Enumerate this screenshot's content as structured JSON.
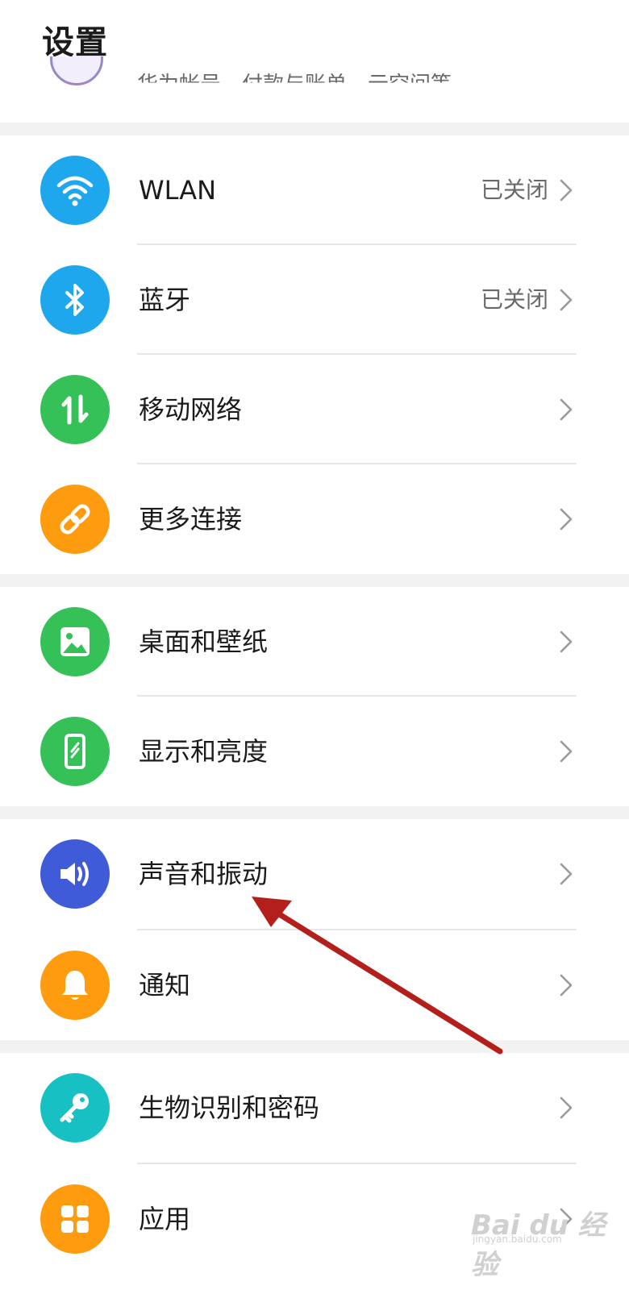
{
  "header": {
    "title": "设置"
  },
  "account": {
    "subtitle": "华为帐号、付款与账单、云空间等"
  },
  "groups": [
    {
      "items": [
        {
          "label": "WLAN",
          "value": "已关闭",
          "icon": "wifi-icon",
          "color": "#1ea7ec"
        },
        {
          "label": "蓝牙",
          "value": "已关闭",
          "icon": "bluetooth-icon",
          "color": "#1ea7ec"
        },
        {
          "label": "移动网络",
          "value": "",
          "icon": "mobile-data-icon",
          "color": "#36c158"
        },
        {
          "label": "更多连接",
          "value": "",
          "icon": "link-icon",
          "color": "#ff9b0f"
        }
      ]
    },
    {
      "items": [
        {
          "label": "桌面和壁纸",
          "value": "",
          "icon": "wallpaper-icon",
          "color": "#36c158"
        },
        {
          "label": "显示和亮度",
          "value": "",
          "icon": "display-icon",
          "color": "#36c158"
        }
      ]
    },
    {
      "items": [
        {
          "label": "声音和振动",
          "value": "",
          "icon": "sound-icon",
          "color": "#3f5bd8"
        },
        {
          "label": "通知",
          "value": "",
          "icon": "bell-icon",
          "color": "#ff9b0f"
        }
      ]
    },
    {
      "items": [
        {
          "label": "生物识别和密码",
          "value": "",
          "icon": "key-icon",
          "color": "#17c0c3"
        },
        {
          "label": "应用",
          "value": "",
          "icon": "apps-icon",
          "color": "#ff9b0f"
        }
      ]
    }
  ],
  "annotation": {
    "color": "#b3201b"
  },
  "watermark": {
    "brand": "Bai du 经验",
    "url": "jingyan.baidu.com"
  }
}
